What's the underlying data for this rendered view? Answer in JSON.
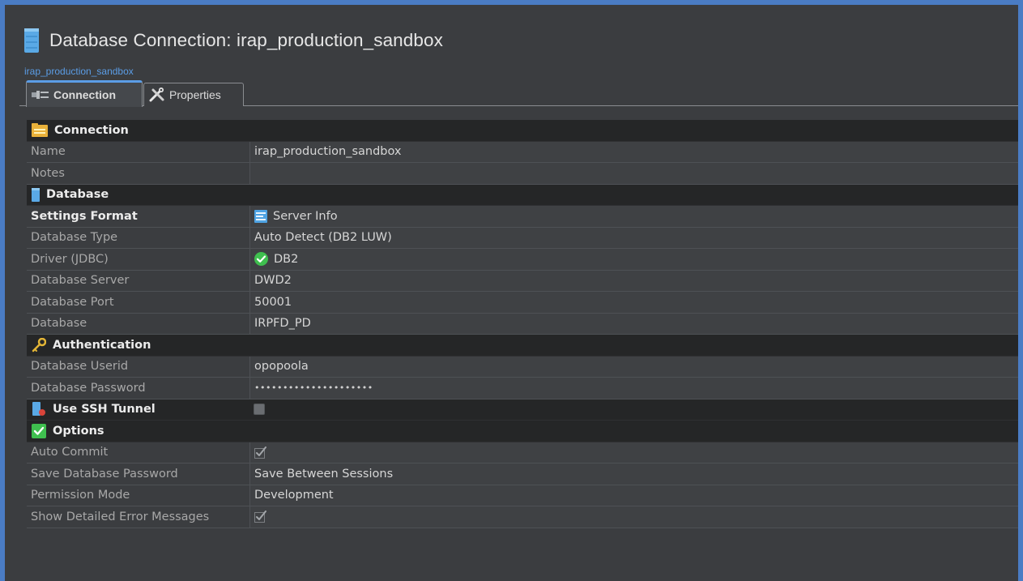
{
  "window": {
    "title": "Database Connection: irap_production_sandbox",
    "breadcrumb": "irap_production_sandbox"
  },
  "tabs": [
    {
      "label": "Connection",
      "icon": "connection-icon",
      "active": true
    },
    {
      "label": "Properties",
      "icon": "tools-icon",
      "active": false
    }
  ],
  "sections": {
    "connection": {
      "title": "Connection",
      "icon": "folder-icon"
    },
    "database": {
      "title": "Database",
      "icon": "database-icon"
    },
    "authentication": {
      "title": "Authentication",
      "icon": "key-icon"
    },
    "ssh": {
      "title": "Use SSH Tunnel",
      "icon": "ssh-tunnel-icon",
      "checked": false
    },
    "options": {
      "title": "Options",
      "icon": "green-check-icon"
    }
  },
  "fields": {
    "name": {
      "label": "Name",
      "value": "irap_production_sandbox"
    },
    "notes": {
      "label": "Notes",
      "value": ""
    },
    "settings_format": {
      "label": "Settings Format",
      "value": "Server Info"
    },
    "database_type": {
      "label": "Database Type",
      "value": "Auto Detect (DB2 LUW)"
    },
    "driver": {
      "label": "Driver (JDBC)",
      "value": "DB2"
    },
    "database_server": {
      "label": "Database Server",
      "value": "DWD2"
    },
    "database_port": {
      "label": "Database Port",
      "value": "50001"
    },
    "database": {
      "label": "Database",
      "value": "IRPFD_PD"
    },
    "database_userid": {
      "label": "Database Userid",
      "value": "opopoola"
    },
    "database_password": {
      "label": "Database Password",
      "value": "•••••••••••••••••••••"
    },
    "auto_commit": {
      "label": "Auto Commit",
      "checked": true
    },
    "save_password": {
      "label": "Save Database Password",
      "value": "Save Between Sessions"
    },
    "permission_mode": {
      "label": "Permission Mode",
      "value": "Development"
    },
    "show_errors": {
      "label": "Show Detailed Error Messages",
      "checked": true
    }
  },
  "colors": {
    "accent": "#5b9de6",
    "panel": "#3b3d40",
    "section_header": "#252627",
    "value_cell": "#3f4144"
  }
}
